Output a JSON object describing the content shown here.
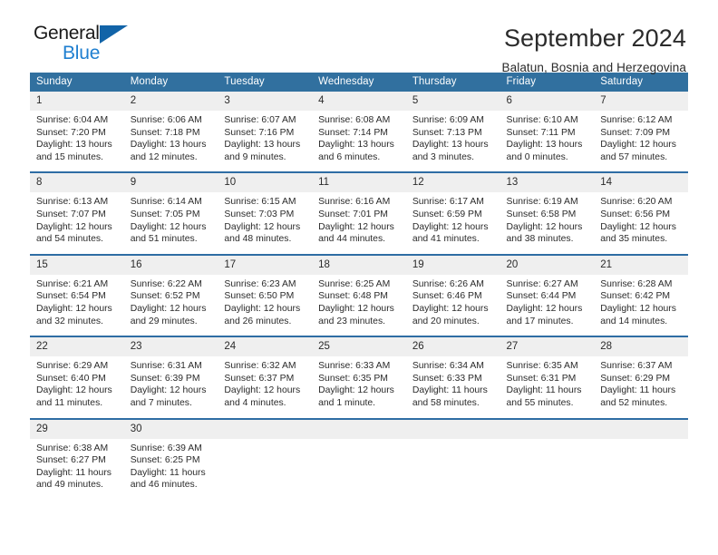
{
  "brand": {
    "name_line1": "General",
    "name_line2": "Blue",
    "triangle_color": "#1264a8",
    "blue_text_color": "#1f7fd0"
  },
  "header": {
    "title": "September 2024",
    "subtitle": "Balatun, Bosnia and Herzegovina"
  },
  "theme": {
    "header_bg": "#31709f",
    "row_divider": "#2e6da4",
    "daynum_bg": "#efefef",
    "text": "#2b2b2b"
  },
  "weekdays": [
    "Sunday",
    "Monday",
    "Tuesday",
    "Wednesday",
    "Thursday",
    "Friday",
    "Saturday"
  ],
  "labels": {
    "sunrise_prefix": "Sunrise:",
    "sunset_prefix": "Sunset:",
    "daylight_prefix": "Daylight:"
  },
  "weeks": [
    [
      {
        "day": "1",
        "sunrise": "Sunrise: 6:04 AM",
        "sunset": "Sunset: 7:20 PM",
        "daylight_1": "Daylight: 13 hours",
        "daylight_2": "and 15 minutes."
      },
      {
        "day": "2",
        "sunrise": "Sunrise: 6:06 AM",
        "sunset": "Sunset: 7:18 PM",
        "daylight_1": "Daylight: 13 hours",
        "daylight_2": "and 12 minutes."
      },
      {
        "day": "3",
        "sunrise": "Sunrise: 6:07 AM",
        "sunset": "Sunset: 7:16 PM",
        "daylight_1": "Daylight: 13 hours",
        "daylight_2": "and 9 minutes."
      },
      {
        "day": "4",
        "sunrise": "Sunrise: 6:08 AM",
        "sunset": "Sunset: 7:14 PM",
        "daylight_1": "Daylight: 13 hours",
        "daylight_2": "and 6 minutes."
      },
      {
        "day": "5",
        "sunrise": "Sunrise: 6:09 AM",
        "sunset": "Sunset: 7:13 PM",
        "daylight_1": "Daylight: 13 hours",
        "daylight_2": "and 3 minutes."
      },
      {
        "day": "6",
        "sunrise": "Sunrise: 6:10 AM",
        "sunset": "Sunset: 7:11 PM",
        "daylight_1": "Daylight: 13 hours",
        "daylight_2": "and 0 minutes."
      },
      {
        "day": "7",
        "sunrise": "Sunrise: 6:12 AM",
        "sunset": "Sunset: 7:09 PM",
        "daylight_1": "Daylight: 12 hours",
        "daylight_2": "and 57 minutes."
      }
    ],
    [
      {
        "day": "8",
        "sunrise": "Sunrise: 6:13 AM",
        "sunset": "Sunset: 7:07 PM",
        "daylight_1": "Daylight: 12 hours",
        "daylight_2": "and 54 minutes."
      },
      {
        "day": "9",
        "sunrise": "Sunrise: 6:14 AM",
        "sunset": "Sunset: 7:05 PM",
        "daylight_1": "Daylight: 12 hours",
        "daylight_2": "and 51 minutes."
      },
      {
        "day": "10",
        "sunrise": "Sunrise: 6:15 AM",
        "sunset": "Sunset: 7:03 PM",
        "daylight_1": "Daylight: 12 hours",
        "daylight_2": "and 48 minutes."
      },
      {
        "day": "11",
        "sunrise": "Sunrise: 6:16 AM",
        "sunset": "Sunset: 7:01 PM",
        "daylight_1": "Daylight: 12 hours",
        "daylight_2": "and 44 minutes."
      },
      {
        "day": "12",
        "sunrise": "Sunrise: 6:17 AM",
        "sunset": "Sunset: 6:59 PM",
        "daylight_1": "Daylight: 12 hours",
        "daylight_2": "and 41 minutes."
      },
      {
        "day": "13",
        "sunrise": "Sunrise: 6:19 AM",
        "sunset": "Sunset: 6:58 PM",
        "daylight_1": "Daylight: 12 hours",
        "daylight_2": "and 38 minutes."
      },
      {
        "day": "14",
        "sunrise": "Sunrise: 6:20 AM",
        "sunset": "Sunset: 6:56 PM",
        "daylight_1": "Daylight: 12 hours",
        "daylight_2": "and 35 minutes."
      }
    ],
    [
      {
        "day": "15",
        "sunrise": "Sunrise: 6:21 AM",
        "sunset": "Sunset: 6:54 PM",
        "daylight_1": "Daylight: 12 hours",
        "daylight_2": "and 32 minutes."
      },
      {
        "day": "16",
        "sunrise": "Sunrise: 6:22 AM",
        "sunset": "Sunset: 6:52 PM",
        "daylight_1": "Daylight: 12 hours",
        "daylight_2": "and 29 minutes."
      },
      {
        "day": "17",
        "sunrise": "Sunrise: 6:23 AM",
        "sunset": "Sunset: 6:50 PM",
        "daylight_1": "Daylight: 12 hours",
        "daylight_2": "and 26 minutes."
      },
      {
        "day": "18",
        "sunrise": "Sunrise: 6:25 AM",
        "sunset": "Sunset: 6:48 PM",
        "daylight_1": "Daylight: 12 hours",
        "daylight_2": "and 23 minutes."
      },
      {
        "day": "19",
        "sunrise": "Sunrise: 6:26 AM",
        "sunset": "Sunset: 6:46 PM",
        "daylight_1": "Daylight: 12 hours",
        "daylight_2": "and 20 minutes."
      },
      {
        "day": "20",
        "sunrise": "Sunrise: 6:27 AM",
        "sunset": "Sunset: 6:44 PM",
        "daylight_1": "Daylight: 12 hours",
        "daylight_2": "and 17 minutes."
      },
      {
        "day": "21",
        "sunrise": "Sunrise: 6:28 AM",
        "sunset": "Sunset: 6:42 PM",
        "daylight_1": "Daylight: 12 hours",
        "daylight_2": "and 14 minutes."
      }
    ],
    [
      {
        "day": "22",
        "sunrise": "Sunrise: 6:29 AM",
        "sunset": "Sunset: 6:40 PM",
        "daylight_1": "Daylight: 12 hours",
        "daylight_2": "and 11 minutes."
      },
      {
        "day": "23",
        "sunrise": "Sunrise: 6:31 AM",
        "sunset": "Sunset: 6:39 PM",
        "daylight_1": "Daylight: 12 hours",
        "daylight_2": "and 7 minutes."
      },
      {
        "day": "24",
        "sunrise": "Sunrise: 6:32 AM",
        "sunset": "Sunset: 6:37 PM",
        "daylight_1": "Daylight: 12 hours",
        "daylight_2": "and 4 minutes."
      },
      {
        "day": "25",
        "sunrise": "Sunrise: 6:33 AM",
        "sunset": "Sunset: 6:35 PM",
        "daylight_1": "Daylight: 12 hours",
        "daylight_2": "and 1 minute."
      },
      {
        "day": "26",
        "sunrise": "Sunrise: 6:34 AM",
        "sunset": "Sunset: 6:33 PM",
        "daylight_1": "Daylight: 11 hours",
        "daylight_2": "and 58 minutes."
      },
      {
        "day": "27",
        "sunrise": "Sunrise: 6:35 AM",
        "sunset": "Sunset: 6:31 PM",
        "daylight_1": "Daylight: 11 hours",
        "daylight_2": "and 55 minutes."
      },
      {
        "day": "28",
        "sunrise": "Sunrise: 6:37 AM",
        "sunset": "Sunset: 6:29 PM",
        "daylight_1": "Daylight: 11 hours",
        "daylight_2": "and 52 minutes."
      }
    ],
    [
      {
        "day": "29",
        "sunrise": "Sunrise: 6:38 AM",
        "sunset": "Sunset: 6:27 PM",
        "daylight_1": "Daylight: 11 hours",
        "daylight_2": "and 49 minutes."
      },
      {
        "day": "30",
        "sunrise": "Sunrise: 6:39 AM",
        "sunset": "Sunset: 6:25 PM",
        "daylight_1": "Daylight: 11 hours",
        "daylight_2": "and 46 minutes."
      },
      {
        "day": "",
        "sunrise": "",
        "sunset": "",
        "daylight_1": "",
        "daylight_2": ""
      },
      {
        "day": "",
        "sunrise": "",
        "sunset": "",
        "daylight_1": "",
        "daylight_2": ""
      },
      {
        "day": "",
        "sunrise": "",
        "sunset": "",
        "daylight_1": "",
        "daylight_2": ""
      },
      {
        "day": "",
        "sunrise": "",
        "sunset": "",
        "daylight_1": "",
        "daylight_2": ""
      },
      {
        "day": "",
        "sunrise": "",
        "sunset": "",
        "daylight_1": "",
        "daylight_2": ""
      }
    ]
  ]
}
